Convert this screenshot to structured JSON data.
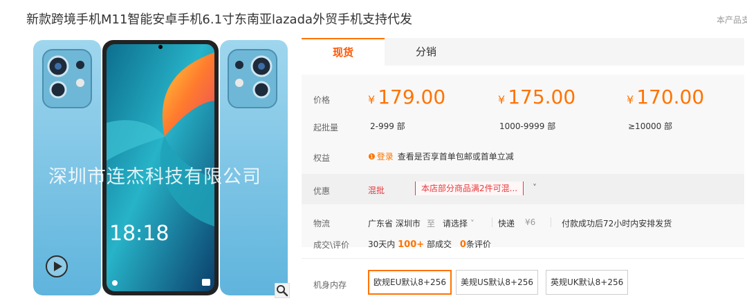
{
  "product": {
    "title": "新款跨境手机M11智能安卓手机6.1寸东南亚lazada外贸手机支持代发",
    "side_note": "本产品支"
  },
  "gallery": {
    "watermark": "深圳市连杰科技有限公司",
    "lock_time": "18:18",
    "play_icon": "play-icon",
    "zoom_icon": "magnifier-icon"
  },
  "tabs": [
    {
      "label": "现货"
    },
    {
      "label": "分销"
    }
  ],
  "pricing": {
    "label": "价格",
    "currency": "¥",
    "tiers": [
      {
        "price": "179.00",
        "qty": "2-999 部"
      },
      {
        "price": "175.00",
        "qty": "1000-9999 部"
      },
      {
        "price": "170.00",
        "qty": "≥10000 部"
      }
    ],
    "qty_label": "起批量"
  },
  "benefit": {
    "label": "权益",
    "login": "登录",
    "text": "查看是否享首单包邮或首单立减"
  },
  "promo": {
    "label": "优惠",
    "mix": "混批",
    "tag": "本店部分商品满2件可混..."
  },
  "shipping": {
    "label": "物流",
    "from": "广东省 深圳市",
    "to_word": "至",
    "select": "请选择",
    "method": "快递",
    "fee": "¥6",
    "note": "付款成功后72小时内安排发货"
  },
  "deals": {
    "label": "成交\\评价",
    "prefix": "30天内",
    "count": "100+",
    "mid": "部成交",
    "reviews": "0",
    "suffix": "条评价"
  },
  "spec": {
    "label": "机身内存",
    "options": [
      {
        "label": "欧规EU默认8+256",
        "selected": true
      },
      {
        "label": "美规US默认8+256",
        "selected": false
      },
      {
        "label": "英规UK默认8+256",
        "selected": false
      }
    ]
  },
  "colors": {
    "accent": "#ff7300",
    "promo_red": "#e4393c",
    "phone_blue": "#8fcde8"
  }
}
